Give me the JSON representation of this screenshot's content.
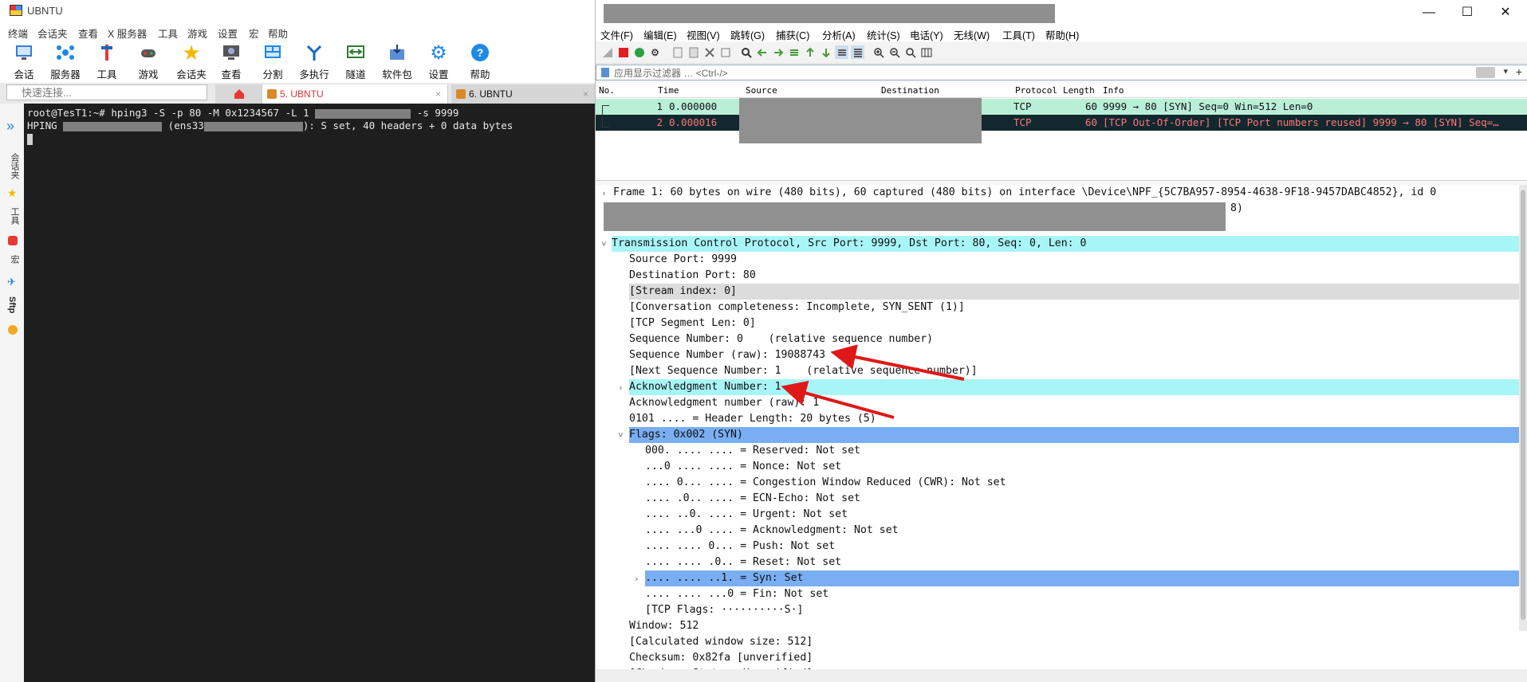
{
  "left": {
    "title": "UBNTU",
    "menu": [
      "终端",
      "会话夹",
      "查看",
      "X 服务器",
      "工具",
      "游戏",
      "设置",
      "宏",
      "帮助"
    ],
    "toolbar": [
      {
        "label": "会话",
        "icon": "session-icon"
      },
      {
        "label": "服务器",
        "icon": "servers-icon"
      },
      {
        "label": "工具",
        "icon": "tools-icon"
      },
      {
        "label": "游戏",
        "icon": "games-icon"
      },
      {
        "label": "会话夹",
        "icon": "star-icon"
      },
      {
        "label": "查看",
        "icon": "view-icon"
      },
      {
        "label": "分割",
        "icon": "split-icon"
      },
      {
        "label": "多执行",
        "icon": "multiexec-icon"
      },
      {
        "label": "隧道",
        "icon": "tunnel-icon"
      },
      {
        "label": "软件包",
        "icon": "packages-icon"
      },
      {
        "label": "设置",
        "icon": "settings-icon"
      },
      {
        "label": "帮助",
        "icon": "help-icon"
      }
    ],
    "quick_connect_placeholder": "快速连接...",
    "tabs": [
      {
        "label": "5. UBNTU",
        "close": "×"
      },
      {
        "label": "6. UBNTU",
        "close": "×"
      }
    ],
    "sidebar": [
      "会话夹",
      "工具",
      "宏",
      "Sftp"
    ],
    "terminal": {
      "line1_prefix": "root@TesT1:~# hping3 -S -p 80 -M 0x1234567 -L 1 ",
      "line1_suffix": " -s 9999",
      "line2_prefix": "HPING ",
      "line2_mid": " (ens33",
      "line2_suffix": "): S set, 40 headers + 0 data bytes"
    }
  },
  "wireshark": {
    "window_controls": {
      "minimize": "—",
      "maximize": "☐",
      "close": "✕"
    },
    "menu": [
      "文件(F)",
      "编辑(E)",
      "视图(V)",
      "跳转(G)",
      "捕获(C)",
      "分析(A)",
      "统计(S)",
      "电话(Y)",
      "无线(W)",
      "工具(T)",
      "帮助(H)"
    ],
    "filter_placeholder": "应用显示过滤器 … <Ctrl-/>",
    "columns": [
      "No.",
      "Time",
      "Source",
      "Destination",
      "Protocol",
      "Length",
      "Info"
    ],
    "packets": [
      {
        "no": "1",
        "time": "0.000000",
        "protocol": "TCP",
        "length": "60",
        "info": "9999 → 80 [SYN] Seq=0 Win=512 Len=0"
      },
      {
        "no": "2",
        "time": "0.000016",
        "protocol": "TCP",
        "length": "60",
        "info": "[TCP Out-Of-Order] [TCP Port numbers reused] 9999 → 80 [SYN] Seq=…"
      }
    ],
    "details": {
      "frame": "Frame 1: 60 bytes on wire (480 bits), 60 captured (480 bits) on interface \\Device\\NPF_{5C7BA957-8954-4638-9F18-9457DABC4852}, id 0",
      "frame_tail": "8)",
      "tcp": "Transmission Control Protocol, Src Port: 9999, Dst Port: 80, Seq: 0, Len: 0",
      "src_port": "Source Port: 9999",
      "dst_port": "Destination Port: 80",
      "stream": "[Stream index: 0]",
      "conversation": "[Conversation completeness: Incomplete, SYN_SENT (1)]",
      "seglen": "[TCP Segment Len: 0]",
      "seq": "Sequence Number: 0    (relative sequence number)",
      "seq_raw": "Sequence Number (raw): 19088743",
      "next_seq": "[Next Sequence Number: 1    (relative sequence number)]",
      "ack": "Acknowledgment Number: 1",
      "ack_raw": "Acknowledgment number (raw): 1",
      "header_len": "0101 .... = Header Length: 20 bytes (5)",
      "flags": "Flags: 0x002 (SYN)",
      "f_reserved": "000. .... .... = Reserved: Not set",
      "f_nonce": "...0 .... .... = Nonce: Not set",
      "f_cwr": ".... 0... .... = Congestion Window Reduced (CWR): Not set",
      "f_ecn": ".... .0.. .... = ECN-Echo: Not set",
      "f_urg": ".... ..0. .... = Urgent: Not set",
      "f_ack": ".... ...0 .... = Acknowledgment: Not set",
      "f_push": ".... .... 0... = Push: Not set",
      "f_reset": ".... .... .0.. = Reset: Not set",
      "f_syn": ".... .... ..1. = Syn: Set",
      "f_fin": ".... .... ...0 = Fin: Not set",
      "tcp_flags": "[TCP Flags: ··········S·]",
      "window": "Window: 512",
      "calc_window": "[Calculated window size: 512]",
      "checksum": "Checksum: 0x82fa [unverified]",
      "checksum_status": "[Checksum Status: Unverified]"
    },
    "colors": {
      "row1": "#b9efd6",
      "row2": "#12272e",
      "cyan_highlight": "#a8f5f8",
      "blue_highlight": "#79aef2",
      "annotation_arrow": "#e01818"
    }
  }
}
